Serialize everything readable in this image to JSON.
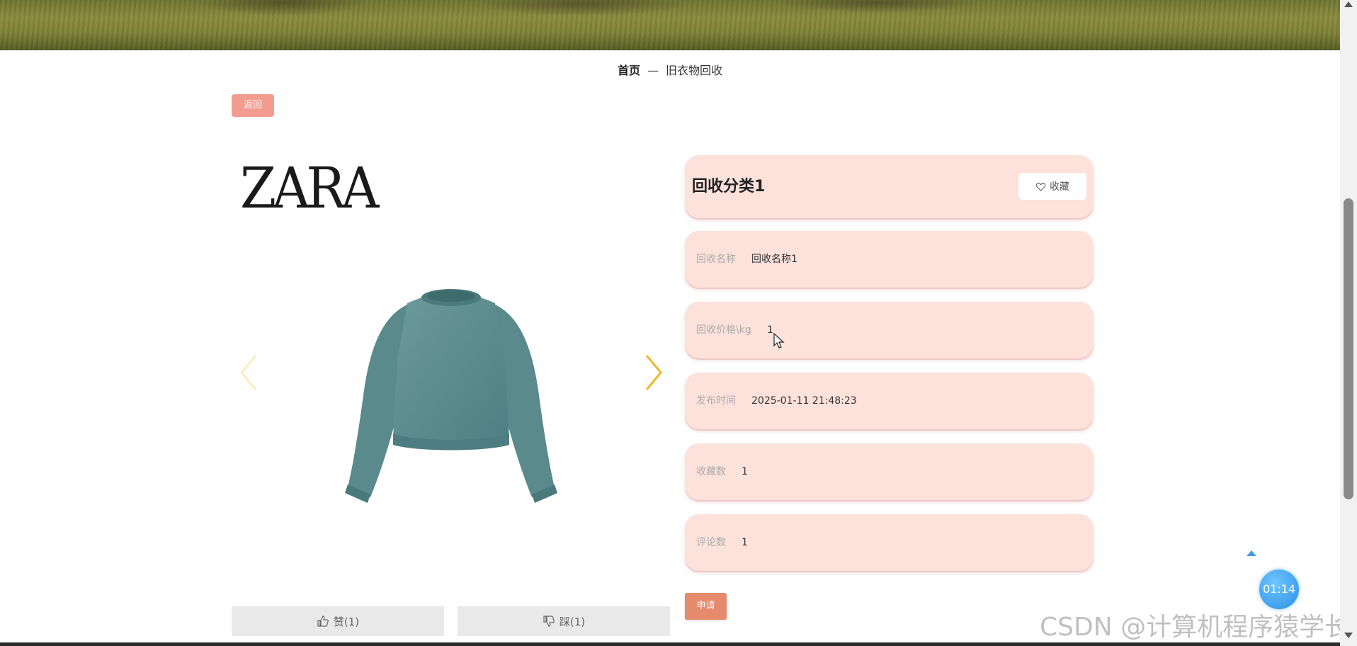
{
  "breadcrumb": {
    "home": "首页",
    "separator": "—",
    "current": "旧衣物回收"
  },
  "back_button": "返回",
  "gallery": {
    "brand_logo": "ZARA",
    "image_icon": "sweatshirt-image",
    "prev_icon": "chevron-left-icon",
    "next_icon": "chevron-right-icon"
  },
  "votes": {
    "like": "赞(1)",
    "dislike": "踩(1)"
  },
  "detail": {
    "title": "回收分类1",
    "favorite_button": "收藏",
    "fields": [
      {
        "label": "回收名称",
        "value": "回收名称1"
      },
      {
        "label": "回收价格\\kg",
        "value": "1"
      },
      {
        "label": "发布时间",
        "value": "2025-01-11 21:48:23"
      },
      {
        "label": "收藏数",
        "value": "1"
      },
      {
        "label": "评论数",
        "value": "1"
      }
    ],
    "apply_button": "申请"
  },
  "timer": "01:14",
  "watermark": "CSDN @计算机程序猿学长",
  "colors": {
    "card_bg": "#fde1db",
    "back_button": "#f29c8f",
    "apply_button": "#e58a6d",
    "arrow": "#f2b632"
  }
}
